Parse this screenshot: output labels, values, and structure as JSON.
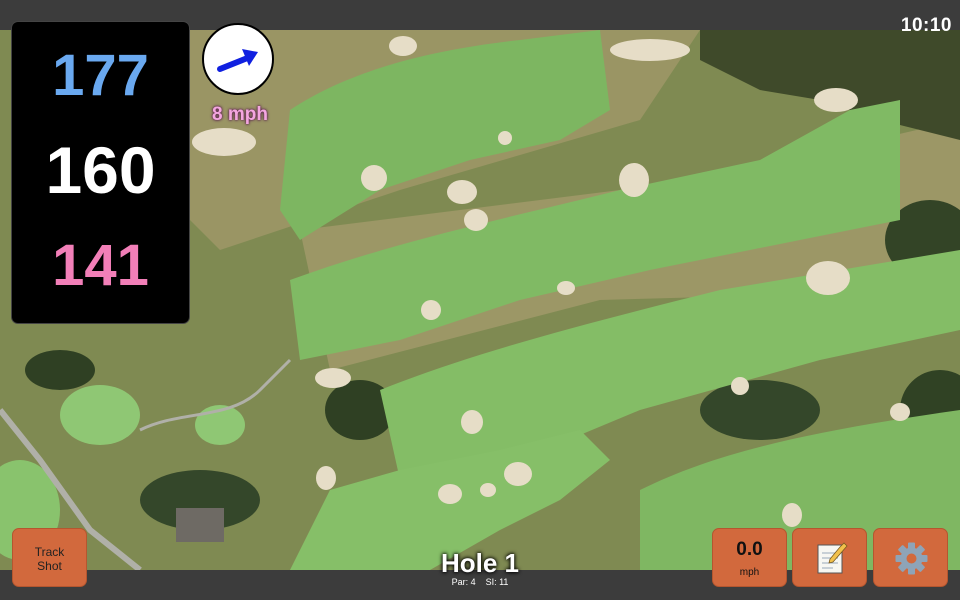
{
  "clock": {
    "time": "10:10"
  },
  "distances": {
    "back": "177",
    "middle": "160",
    "front": "141"
  },
  "wind": {
    "speed_label": "8 mph"
  },
  "buttons": {
    "track_shot_line1": "Track",
    "track_shot_line2": "Shot",
    "speed_value": "0.0",
    "speed_unit": "mph",
    "notes_icon": "notepad-icon",
    "settings_icon": "gear-icon"
  },
  "hole": {
    "title": "Hole 1",
    "par_label": "Par: 4",
    "si_label": "SI: 11"
  },
  "colors": {
    "back": "#6aa9f0",
    "middle": "#ffffff",
    "front": "#f27fb8",
    "button": "#d2693d",
    "bar": "#3c3c3c"
  }
}
